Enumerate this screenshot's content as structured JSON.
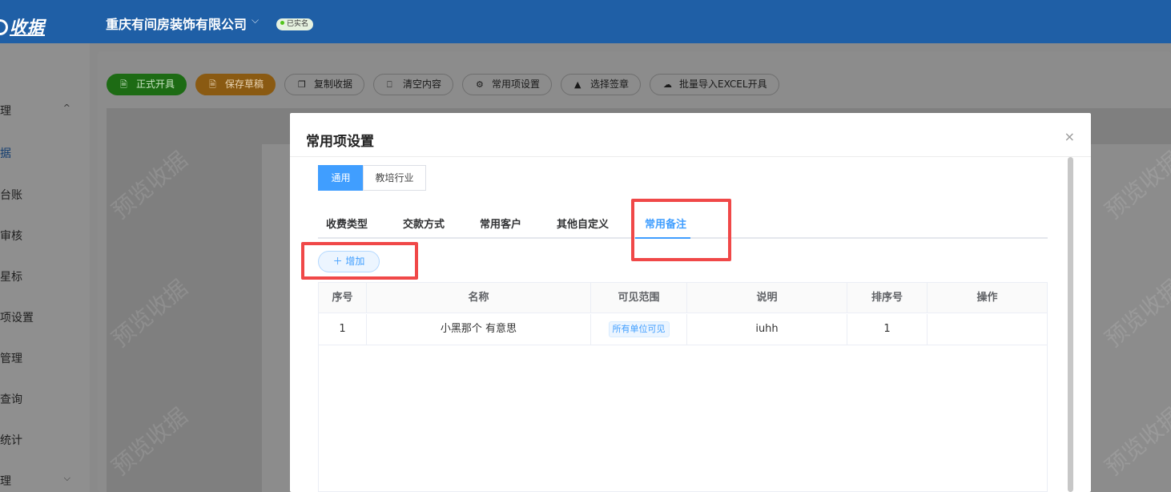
{
  "header": {
    "logo_text": "收据",
    "company": "重庆有间房装饰有限公司",
    "company_caret": "⌵",
    "verified_badge": "已实名"
  },
  "sidebar": {
    "items": [
      {
        "label": "理",
        "caret": "^"
      },
      {
        "label": "据"
      },
      {
        "label": "台账"
      },
      {
        "label": "审核"
      },
      {
        "label": "星标"
      },
      {
        "label": "项设置"
      },
      {
        "label": "管理"
      },
      {
        "label": "查询"
      },
      {
        "label": "统计"
      },
      {
        "label": "理",
        "caret": "⌵"
      }
    ]
  },
  "toolbar": {
    "buttons": [
      {
        "label": "正式开具",
        "icon": "document-icon"
      },
      {
        "label": "保存草稿",
        "icon": "document-icon"
      },
      {
        "label": "复制收据",
        "icon": "copy-icon"
      },
      {
        "label": "清空内容",
        "icon": "eraser-icon"
      },
      {
        "label": "常用项设置",
        "icon": "gear-icon"
      },
      {
        "label": "选择签章",
        "icon": "user-icon"
      },
      {
        "label": "批量导入EXCEL开具",
        "icon": "cloud-upload-icon"
      }
    ]
  },
  "watermark_text": "预览收据",
  "modal": {
    "title": "常用项设置",
    "close": "×",
    "segments": [
      {
        "label": "通用",
        "active": true
      },
      {
        "label": "教培行业",
        "active": false
      }
    ],
    "tabs": [
      {
        "label": "收费类型"
      },
      {
        "label": "交款方式"
      },
      {
        "label": "常用客户"
      },
      {
        "label": "其他自定义"
      },
      {
        "label": "常用备注",
        "active": true
      }
    ],
    "add_button": "增加",
    "add_icon": "＋",
    "table": {
      "columns": [
        "序号",
        "名称",
        "可见范围",
        "说明",
        "排序号",
        "操作"
      ],
      "rows": [
        {
          "index": "1",
          "name": "小黑那个 有意思",
          "scope": "所有单位可见",
          "desc": "iuhh",
          "order": "1",
          "actions": ""
        }
      ]
    }
  },
  "colors": {
    "topbar": "#1f5fa6",
    "primary": "#409eff",
    "highlight": "#f04848",
    "green_button": "#1d6b14",
    "orange_button": "#8a5a12"
  }
}
